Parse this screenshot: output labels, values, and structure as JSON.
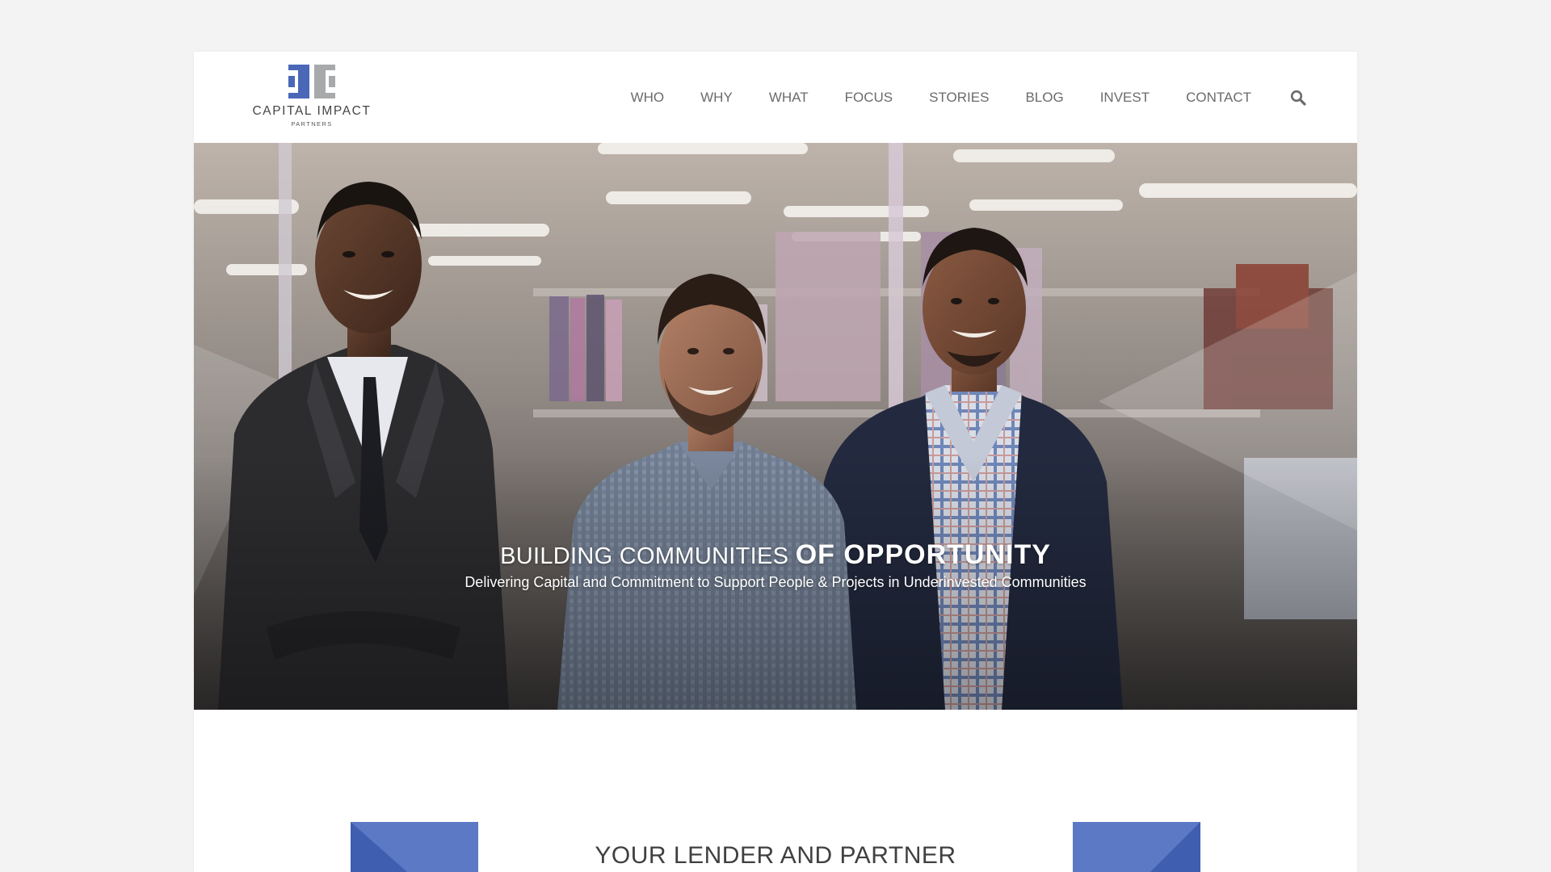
{
  "brand": {
    "name": "CAPITAL IMPACT",
    "subname": "PARTNERS",
    "colors": {
      "blue": "#4a67b8",
      "gray": "#a7a9ab"
    }
  },
  "nav": {
    "items": [
      {
        "label": "WHO"
      },
      {
        "label": "WHY"
      },
      {
        "label": "WHAT"
      },
      {
        "label": "FOCUS"
      },
      {
        "label": "STORIES"
      },
      {
        "label": "BLOG"
      },
      {
        "label": "INVEST"
      },
      {
        "label": "CONTACT"
      }
    ],
    "search_icon": "search-icon"
  },
  "hero": {
    "title_light": "BUILDING COMMUNITIES",
    "title_bold": "OF OPPORTUNITY",
    "subtitle": "Delivering Capital and Commitment to Support People & Projects in Underinvested Communities"
  },
  "section": {
    "title": "YOUR LENDER AND PARTNER"
  },
  "colors": {
    "page_background": "#f3f3f3",
    "accent_blue": "#5b79c4",
    "nav_text": "#6b6b6b"
  }
}
